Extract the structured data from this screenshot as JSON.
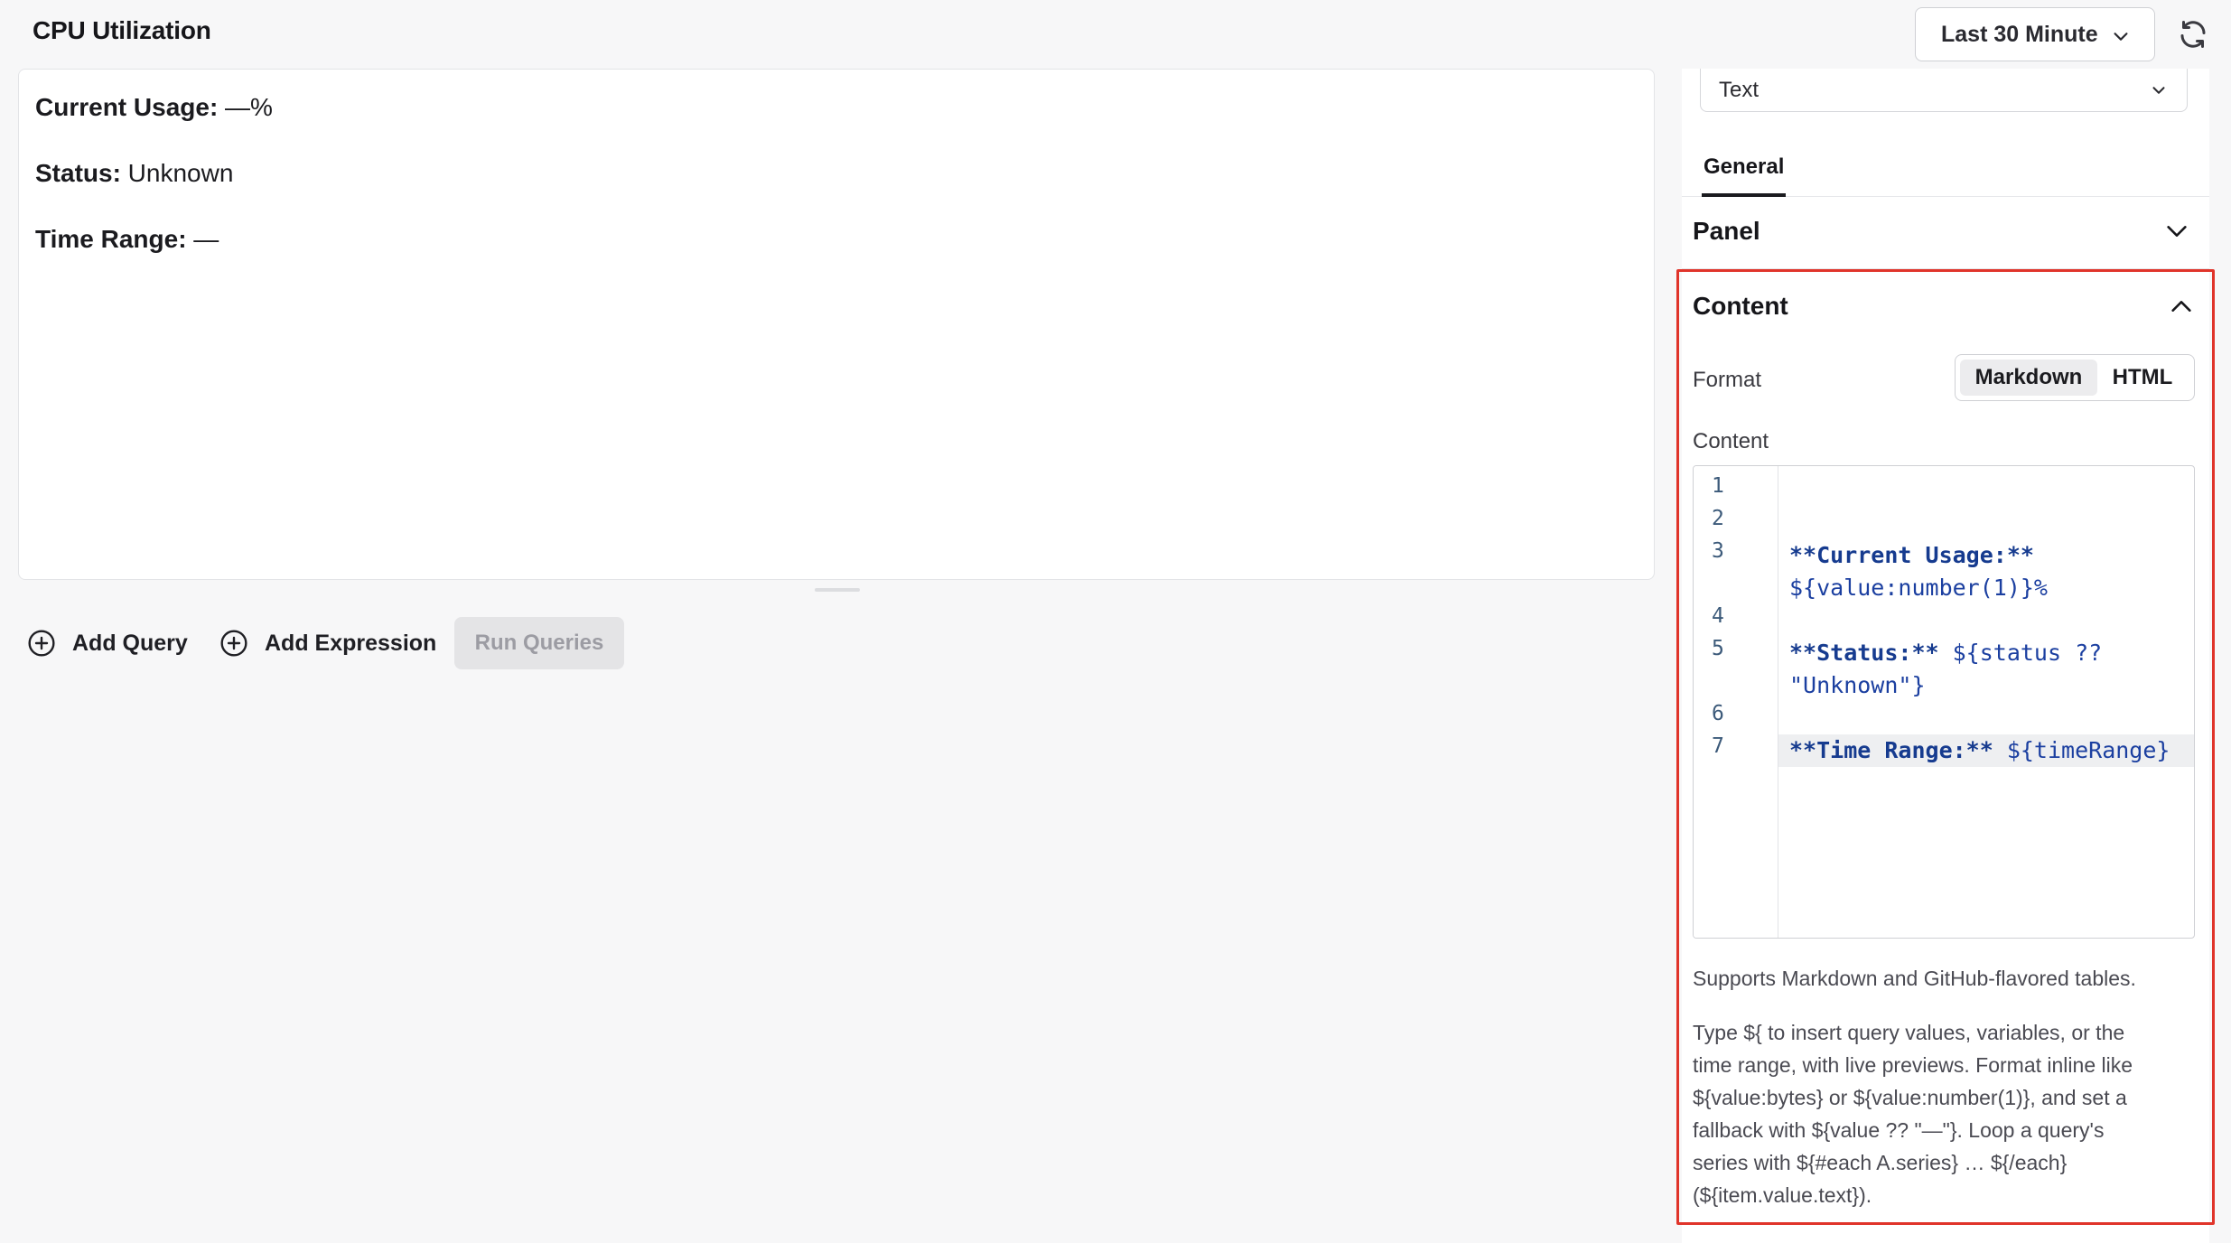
{
  "header": {
    "panel_title": "CPU Utilization",
    "time_range_label": "Last 30 Minute"
  },
  "preview": {
    "rows": [
      {
        "label": "Current Usage:",
        "value": " —%"
      },
      {
        "label": "Status:",
        "value": " Unknown"
      },
      {
        "label": "Time Range:",
        "value": " —"
      }
    ]
  },
  "query_bar": {
    "add_query": "Add Query",
    "add_expression": "Add Expression",
    "run_queries": "Run Queries"
  },
  "sidebar": {
    "visualization": "Text",
    "tabs": [
      {
        "label": "General",
        "active": true
      }
    ],
    "panel_section": "Panel",
    "content_section": {
      "title": "Content",
      "format_label": "Format",
      "format_options": [
        "Markdown",
        "HTML"
      ],
      "format_selected": "Markdown",
      "content_label": "Content",
      "editor": {
        "line_numbers": [
          "1",
          "2",
          "3",
          "4",
          "5",
          "6",
          "7"
        ],
        "lines": [
          {
            "bold": "",
            "text": ""
          },
          {
            "bold": "",
            "text": ""
          },
          {
            "bold": "**Current Usage:**",
            "text": ""
          },
          {
            "bold": "",
            "text": "${value:number(1)}%"
          },
          {
            "bold": "**Status:**",
            "text": " ${status ??"
          },
          {
            "bold": "",
            "text": "\"Unknown\"}"
          },
          {
            "bold": "**Time Range:**",
            "text": " ${timeRange}"
          }
        ],
        "active_line": 7
      },
      "help_1": "Supports Markdown and GitHub-flavored tables.",
      "help_2": [
        "Type ${ to insert query values, variables, or the",
        "time range, with live previews. Format inline like",
        "${value:bytes} or ${value:number(1)}, and set a",
        "fallback with ${value ?? \"—\"}. Loop a query's",
        "series with ${#each A.series} … ${/each}",
        "(${item.value.text})."
      ]
    }
  },
  "colors": {
    "highlight_border": "#e0342a",
    "code_blue": "#1b3fa0",
    "disabled_bg": "#e4e4e6"
  },
  "icons": [
    "chevron-down-icon",
    "refresh-icon",
    "plus-circle-icon",
    "chevron-up-icon"
  ]
}
